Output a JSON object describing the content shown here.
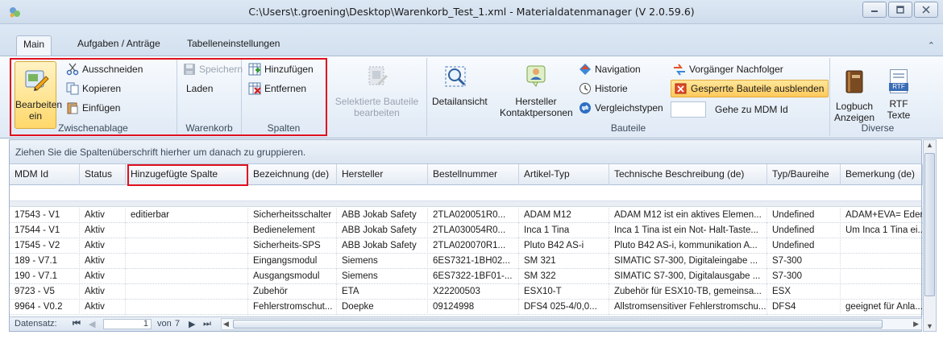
{
  "window": {
    "title": "C:\\Users\\t.groening\\Desktop\\Warenkorb_Test_1.xml - Materialdatenmanager (V 2.0.59.6)"
  },
  "tabs": [
    "Main",
    "Aufgaben / Anträge",
    "Tabelleneinstellungen"
  ],
  "ribbon": {
    "bearbeiten": {
      "line1": "Bearbeiten",
      "line2": "ein"
    },
    "zwischenablage": {
      "label": "Zwischenablage",
      "ausschneiden": "Ausschneiden",
      "kopieren": "Kopieren",
      "einfuegen": "Einfügen"
    },
    "warenkorb": {
      "label": "Warenkorb",
      "speichern": "Speichern",
      "laden": "Laden"
    },
    "spalten": {
      "label": "Spalten",
      "hinzufuegen": "Hinzufügen",
      "entfernen": "Entfernen"
    },
    "selektierte": {
      "line1": "Selektierte Bauteile",
      "line2": "bearbeiten"
    },
    "bauteile": {
      "label": "Bauteile",
      "detailansicht": "Detailansicht",
      "hersteller_line1": "Hersteller",
      "hersteller_line2": "Kontaktpersonen",
      "navigation": "Navigation",
      "historie": "Historie",
      "vergleichstypen": "Vergleichstypen",
      "vorgaenger": "Vorgänger Nachfolger",
      "gesperrte": "Gesperrte Bauteile ausblenden",
      "gehe_zu": "Gehe zu MDM Id"
    },
    "diverse": {
      "label": "Diverse",
      "logbuch_line1": "Logbuch",
      "logbuch_line2": "Anzeigen",
      "rtf_line1": "RTF",
      "rtf_line2": "Texte",
      "rtf_badge": "RTF"
    }
  },
  "grid": {
    "group_hint": "Ziehen Sie die Spaltenüberschrift hierher um danach zu gruppieren.",
    "columns": [
      "MDM Id",
      "Status",
      "Hinzugefügte Spalte",
      "Bezeichnung (de)",
      "Hersteller",
      "Bestellnummer",
      "Artikel-Typ",
      "Technische Beschreibung (de)",
      "Typ/Baureihe",
      "Bemerkung (de)"
    ],
    "rows": [
      [
        "17543 - V1",
        "Aktiv",
        "editierbar",
        "Sicherheitsschalter",
        "ABB Jokab Safety",
        "2TLA020051R0...",
        "ADAM M12",
        "ADAM M12 ist ein aktives Elemen...",
        "Undefined",
        "ADAM+EVA= Eder"
      ],
      [
        "17544 - V1",
        "Aktiv",
        "",
        "Bedienelement",
        "ABB Jokab Safety",
        "2TLA030054R0...",
        "Inca 1 Tina",
        "Inca 1 Tina ist ein Not- Halt-Taste...",
        "Undefined",
        "Um Inca 1 Tina ei..."
      ],
      [
        "17545 - V2",
        "Aktiv",
        "",
        "Sicherheits-SPS",
        "ABB Jokab Safety",
        "2TLA020070R1...",
        "Pluto B42 AS-i",
        "Pluto B42 AS-i, kommunikation  A...",
        "Undefined",
        ""
      ],
      [
        "189 - V7.1",
        "Aktiv",
        "",
        "Eingangsmodul",
        "Siemens",
        "6ES7321-1BH02...",
        "SM 321",
        "SIMATIC S7-300, Digitaleingabe ...",
        "S7-300",
        ""
      ],
      [
        "190 - V7.1",
        "Aktiv",
        "",
        "Ausgangsmodul",
        "Siemens",
        "6ES7322-1BF01-...",
        "SM 322",
        "SIMATIC S7-300, Digitalausgabe ...",
        "S7-300",
        ""
      ],
      [
        "9723 - V5",
        "Aktiv",
        "",
        "Zubehör",
        "ETA",
        "X22200503",
        "ESX10-T",
        "Zubehör für ESX10-TB, gemeinsa...",
        "ESX",
        ""
      ],
      [
        "9964 - V0.2",
        "Aktiv",
        "",
        "Fehlerstromschut...",
        "Doepke",
        "09124998",
        "DFS4 025-4/0,0...",
        "Allstromsensitiver Fehlerstromschu...",
        "DFS4",
        "geeignet für Anla..."
      ]
    ],
    "navigator": {
      "label": "Datensatz:",
      "current": "1",
      "von": "von",
      "total": "7"
    }
  },
  "colors": {
    "highlight": "#e0101e",
    "active_button": "#ffd86b"
  }
}
